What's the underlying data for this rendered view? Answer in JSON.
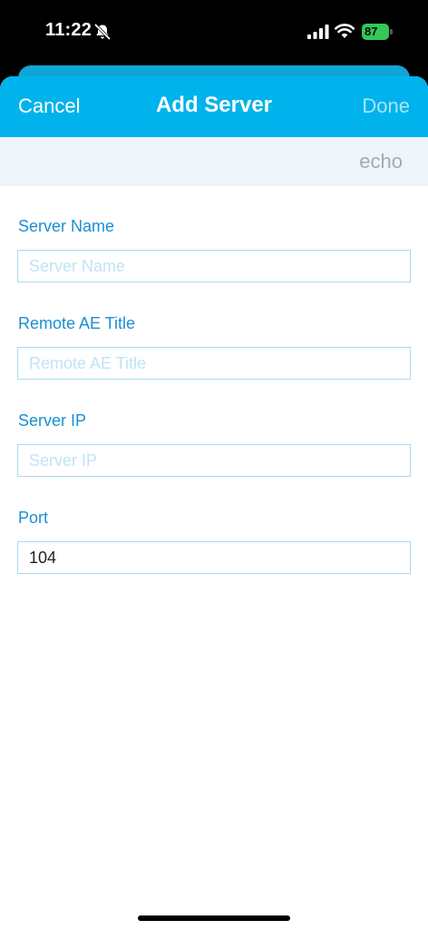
{
  "status_bar": {
    "time": "11:22",
    "battery_level": "87",
    "battery_color": "#34c759"
  },
  "nav": {
    "cancel_label": "Cancel",
    "title": "Add Server",
    "done_label": "Done",
    "background_color": "#00b3ec"
  },
  "toolbar": {
    "echo_label": "echo"
  },
  "form": {
    "server_name": {
      "label": "Server Name",
      "placeholder": "Server Name",
      "value": ""
    },
    "remote_ae_title": {
      "label": "Remote AE Title",
      "placeholder": "Remote AE Title",
      "value": ""
    },
    "server_ip": {
      "label": "Server IP",
      "placeholder": "Server IP",
      "value": ""
    },
    "port": {
      "label": "Port",
      "placeholder": "",
      "value": "104"
    },
    "label_color": "#1a8fd1"
  },
  "icons": {
    "bell": "bell-slash-icon",
    "signal": "cellular-signal-icon",
    "wifi": "wifi-icon",
    "battery": "battery-icon"
  }
}
